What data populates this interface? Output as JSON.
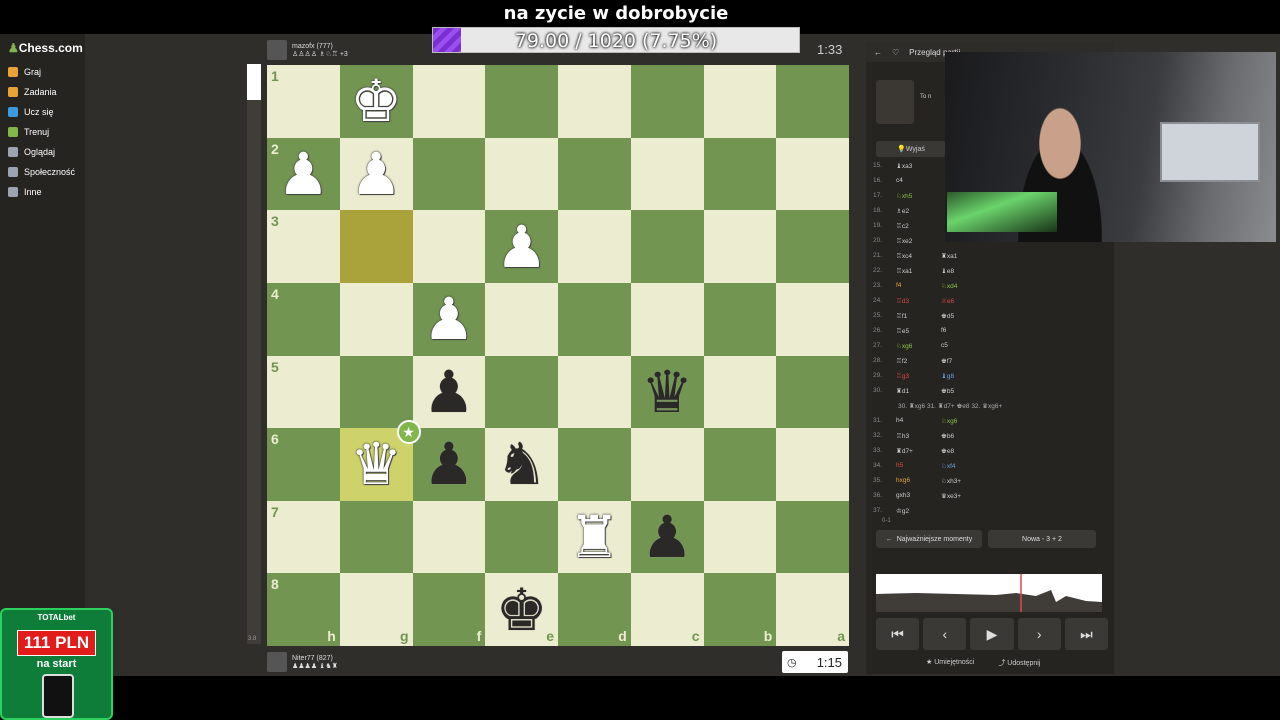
{
  "overlay": {
    "stream_title": "na zycie w dobrobycie",
    "goal_text": "79.00 / 1020 (7.75%)",
    "goal_fraction": 0.0775
  },
  "sidebar": {
    "logo": "Chess.com",
    "items": [
      {
        "label": "Graj",
        "color": "#e8a23a"
      },
      {
        "label": "Zadania",
        "color": "#e8a23a"
      },
      {
        "label": "Ucz się",
        "color": "#3b9ae1"
      },
      {
        "label": "Trenuj",
        "color": "#81b64c"
      },
      {
        "label": "Oglądaj",
        "color": "#9aa5b1"
      },
      {
        "label": "Społeczność",
        "color": "#9aa5b1"
      },
      {
        "label": "Inne",
        "color": "#9aa5b1"
      }
    ]
  },
  "top_player": {
    "name": "mazofx (777)",
    "extra": "+3",
    "clock": "1:33"
  },
  "bottom_player": {
    "name": "Niter77 (827)",
    "clock": "1:15"
  },
  "eval_label": "3.8",
  "board": {
    "ranks": [
      "1",
      "2",
      "3",
      "4",
      "5",
      "6",
      "7",
      "8"
    ],
    "files": [
      "h",
      "g",
      "f",
      "e",
      "d",
      "c",
      "b",
      "a"
    ],
    "pieces": [
      {
        "sq": "g1",
        "glyph": "♚",
        "color": "white"
      },
      {
        "sq": "h2",
        "glyph": "♟",
        "color": "white"
      },
      {
        "sq": "g2",
        "glyph": "♟",
        "color": "white"
      },
      {
        "sq": "e3",
        "glyph": "♟",
        "color": "white"
      },
      {
        "sq": "f4",
        "glyph": "♟",
        "color": "white"
      },
      {
        "sq": "f5",
        "glyph": "♟",
        "color": "black"
      },
      {
        "sq": "c5",
        "glyph": "♛",
        "color": "black"
      },
      {
        "sq": "g6",
        "glyph": "♛",
        "color": "white",
        "star": true
      },
      {
        "sq": "f6",
        "glyph": "♟",
        "color": "black"
      },
      {
        "sq": "e6",
        "glyph": "♞",
        "color": "black"
      },
      {
        "sq": "d7",
        "glyph": "♜",
        "color": "white"
      },
      {
        "sq": "c7",
        "glyph": "♟",
        "color": "black"
      },
      {
        "sq": "e8",
        "glyph": "♚",
        "color": "black"
      }
    ],
    "highlight": [
      "g3",
      "g6"
    ]
  },
  "panel": {
    "title": "Przegląd partii",
    "coach_text": "To n",
    "explain_label": "Wyjaś",
    "moves": [
      {
        "n": "15.",
        "w": "♝xa3",
        "b": ""
      },
      {
        "n": "16.",
        "w": "c4",
        "b": ""
      },
      {
        "n": "17.",
        "w": "♘xh5",
        "b": "",
        "wc": "green"
      },
      {
        "n": "18.",
        "w": "♗e2",
        "b": ""
      },
      {
        "n": "19.",
        "w": "♖c2",
        "b": ""
      },
      {
        "n": "20.",
        "w": "♖xe2",
        "b": ""
      },
      {
        "n": "21.",
        "w": "♖xc4",
        "b": "♜xa1"
      },
      {
        "n": "22.",
        "w": "♖xa1",
        "b": "♝e8"
      },
      {
        "n": "23.",
        "w": "f4",
        "b": "♘xd4",
        "wc": "orange",
        "bc": "green"
      },
      {
        "n": "24.",
        "w": "♖d3",
        "b": "♕e6",
        "wc": "red",
        "bc": "red"
      },
      {
        "n": "25.",
        "w": "♖f1",
        "b": "♚d5"
      },
      {
        "n": "26.",
        "w": "♖e5",
        "b": "f6"
      },
      {
        "n": "27.",
        "w": "♘xg6",
        "b": "c5",
        "wc": "green"
      },
      {
        "n": "28.",
        "w": "♖f2",
        "b": "♚f7"
      },
      {
        "n": "29.",
        "w": "♖g3",
        "b": "♝g8",
        "wc": "red",
        "bc": "blue"
      },
      {
        "n": "30.",
        "w": "♜d1",
        "b": "♚b5"
      },
      {
        "n": "",
        "w": "",
        "b": "",
        "variation": "30. ♜xg6 31. ♜d7+ ♚e8 32. ♛xg6+"
      },
      {
        "n": "31.",
        "w": "h4",
        "b": "♘xg6",
        "bc": "green"
      },
      {
        "n": "32.",
        "w": "♖h3",
        "b": "♚b6"
      },
      {
        "n": "33.",
        "w": "♜d7+",
        "b": "♚e8"
      },
      {
        "n": "34.",
        "w": "h5",
        "b": "♘xf4",
        "wc": "red",
        "bc": "blue"
      },
      {
        "n": "35.",
        "w": "hxg6",
        "b": "♘xh3+",
        "wc": "orange"
      },
      {
        "n": "36.",
        "w": "gxh3",
        "b": "♛xe3+"
      },
      {
        "n": "37.",
        "w": "♔g2",
        "b": ""
      }
    ],
    "result": "0-1",
    "key_moments_label": "Najważniejsze momenty",
    "new_game_label": "Nowa - 3 + 2",
    "skills_label": "Umiejętności",
    "share_label": "Udostępnij"
  },
  "ad": {
    "brand": "TOTALbet",
    "amount": "111 PLN",
    "tag": "na start"
  }
}
